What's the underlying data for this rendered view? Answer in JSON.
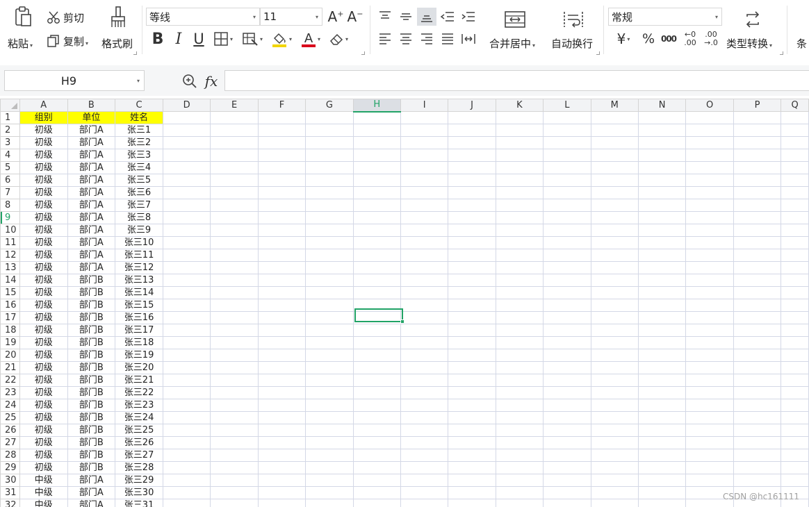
{
  "ribbon": {
    "clipboard": {
      "paste_label": "粘贴",
      "cut_label": "剪切",
      "copy_label": "复制",
      "format_painter_label": "格式刷"
    },
    "font": {
      "name": "等线",
      "size": "11",
      "underline_color": "#d9001b",
      "fill_color": "#f2d600"
    },
    "alignment": {
      "merge_center_label": "合并居中",
      "wrap_text_label": "自动换行"
    },
    "number": {
      "format": "常规",
      "currency_symbol": "¥",
      "percent_symbol": "%",
      "thousands_symbol": "000",
      "increase_decimal": "←0\n.00",
      "decrease_decimal": ".00\n→.0",
      "type_convert_label": "类型转换",
      "cond_label": "条"
    }
  },
  "formula_bar": {
    "cell_ref": "H9",
    "fx_label": "fx",
    "value": ""
  },
  "sheet": {
    "active_cell": "H9",
    "header_fill": "#ffff00",
    "columns": [
      "A",
      "B",
      "C",
      "D",
      "E",
      "F",
      "G",
      "H",
      "I",
      "J",
      "K",
      "L",
      "M",
      "N",
      "O",
      "P",
      "Q"
    ],
    "rows": [
      [
        "组别",
        "单位",
        "姓名"
      ],
      [
        "初级",
        "部门A",
        "张三1"
      ],
      [
        "初级",
        "部门A",
        "张三2"
      ],
      [
        "初级",
        "部门A",
        "张三3"
      ],
      [
        "初级",
        "部门A",
        "张三4"
      ],
      [
        "初级",
        "部门A",
        "张三5"
      ],
      [
        "初级",
        "部门A",
        "张三6"
      ],
      [
        "初级",
        "部门A",
        "张三7"
      ],
      [
        "初级",
        "部门A",
        "张三8"
      ],
      [
        "初级",
        "部门A",
        "张三9"
      ],
      [
        "初级",
        "部门A",
        "张三10"
      ],
      [
        "初级",
        "部门A",
        "张三11"
      ],
      [
        "初级",
        "部门A",
        "张三12"
      ],
      [
        "初级",
        "部门B",
        "张三13"
      ],
      [
        "初级",
        "部门B",
        "张三14"
      ],
      [
        "初级",
        "部门B",
        "张三15"
      ],
      [
        "初级",
        "部门B",
        "张三16"
      ],
      [
        "初级",
        "部门B",
        "张三17"
      ],
      [
        "初级",
        "部门B",
        "张三18"
      ],
      [
        "初级",
        "部门B",
        "张三19"
      ],
      [
        "初级",
        "部门B",
        "张三20"
      ],
      [
        "初级",
        "部门B",
        "张三21"
      ],
      [
        "初级",
        "部门B",
        "张三22"
      ],
      [
        "初级",
        "部门B",
        "张三23"
      ],
      [
        "初级",
        "部门B",
        "张三24"
      ],
      [
        "初级",
        "部门B",
        "张三25"
      ],
      [
        "初级",
        "部门B",
        "张三26"
      ],
      [
        "初级",
        "部门B",
        "张三27"
      ],
      [
        "初级",
        "部门B",
        "张三28"
      ],
      [
        "中级",
        "部门A",
        "张三29"
      ],
      [
        "中级",
        "部门A",
        "张三30"
      ],
      [
        "中级",
        "部门A",
        "张三31"
      ]
    ]
  },
  "watermark": "CSDN @hc161111"
}
